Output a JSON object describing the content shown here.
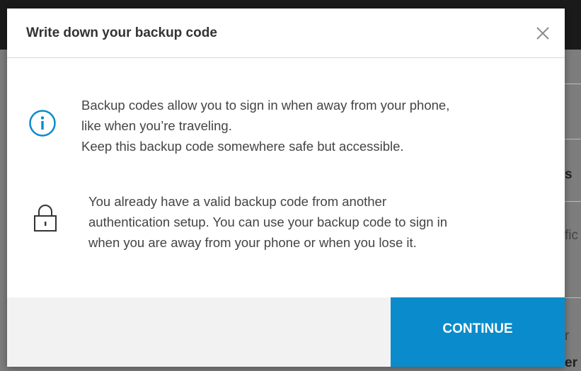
{
  "background": {
    "fragments": [
      "s",
      "fic",
      "r",
      "er"
    ]
  },
  "dialog": {
    "title": "Write down your backup code",
    "close_icon": "close-icon",
    "info_icon": "info-icon",
    "lock_icon": "lock-icon",
    "info_lines": [
      "Backup codes allow you to sign in when away from your phone,",
      "like when you’re traveling.",
      "Keep this backup code somewhere safe but accessible."
    ],
    "lock_lines": [
      "You already have a valid backup code from another",
      "authentication setup. You can use your backup code to sign in",
      "when you are away from your phone or when you lose it."
    ],
    "continue_label": "CONTINUE"
  },
  "colors": {
    "accent": "#0a8ccc",
    "footer": "#f2f2f2",
    "text": "#444444",
    "title": "#333333"
  }
}
